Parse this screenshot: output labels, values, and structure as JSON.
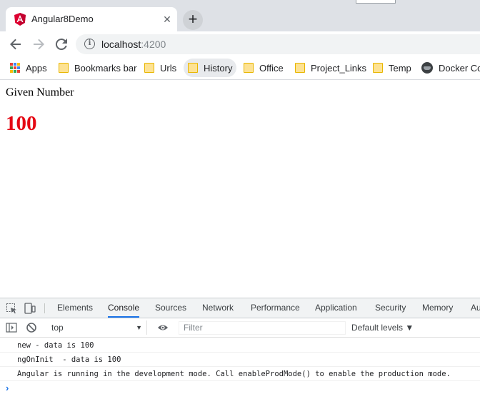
{
  "browser": {
    "tab": {
      "title": "Angular8Demo",
      "close_glyph": "✕"
    },
    "newtab_glyph": "+",
    "address": {
      "host": "localhost",
      "port": ":4200"
    },
    "bookmarks": [
      {
        "label": "Apps",
        "icon": "apps-grid-icon"
      },
      {
        "label": "Bookmarks bar",
        "icon": "folder-icon"
      },
      {
        "label": "Urls",
        "icon": "folder-icon"
      },
      {
        "label": "History",
        "icon": "folder-icon",
        "active": true
      },
      {
        "label": "Office",
        "icon": "folder-icon"
      },
      {
        "label": "Project_Links",
        "icon": "folder-icon"
      },
      {
        "label": "Temp",
        "icon": "folder-icon"
      },
      {
        "label": "Docker Con",
        "icon": "docker-icon"
      }
    ]
  },
  "page": {
    "label": "Given Number",
    "number": "100"
  },
  "devtools": {
    "tabs": [
      "Elements",
      "Console",
      "Sources",
      "Network",
      "Performance",
      "Application",
      "Security",
      "Memory",
      "Au"
    ],
    "active_tab": "Console",
    "context": "top",
    "filter_placeholder": "Filter",
    "levels": "Default levels ▼",
    "console_lines": [
      "new - data is 100",
      "ngOnInit  - data is 100",
      "Angular is running in the development mode. Call enableProdMode() to enable the production mode."
    ],
    "prompt": "›"
  },
  "colors": {
    "number": "#e50914",
    "accent": "#1a73e8",
    "tabstrip": "#dee1e6"
  }
}
